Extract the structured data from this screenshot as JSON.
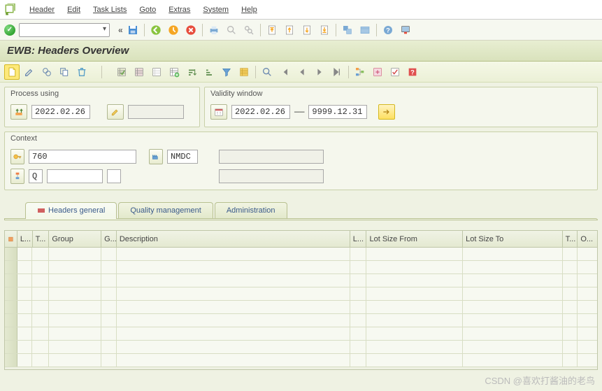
{
  "menu": {
    "items": [
      "Header",
      "Edit",
      "Task Lists",
      "Goto",
      "Extras",
      "System",
      "Help"
    ]
  },
  "page_title": "EWB: Headers Overview",
  "panels": {
    "process_using": {
      "title": "Process using",
      "date": "2022.02.26"
    },
    "validity": {
      "title": "Validity window",
      "from": "2022.02.26",
      "sep": "——",
      "to": "9999.12.31"
    },
    "context": {
      "title": "Context",
      "val1": "760",
      "val2": "NMDC",
      "val3": "Q"
    }
  },
  "tabs": {
    "items": [
      "Headers general",
      "Quality management",
      "Administration"
    ],
    "active": 0
  },
  "grid": {
    "columns": [
      "L...",
      "T...",
      "Group",
      "G...",
      "Description",
      "L...",
      "Lot Size From",
      "Lot Size To",
      "T...",
      "O..."
    ]
  },
  "watermark": "CSDN @喜欢打酱油的老鸟"
}
